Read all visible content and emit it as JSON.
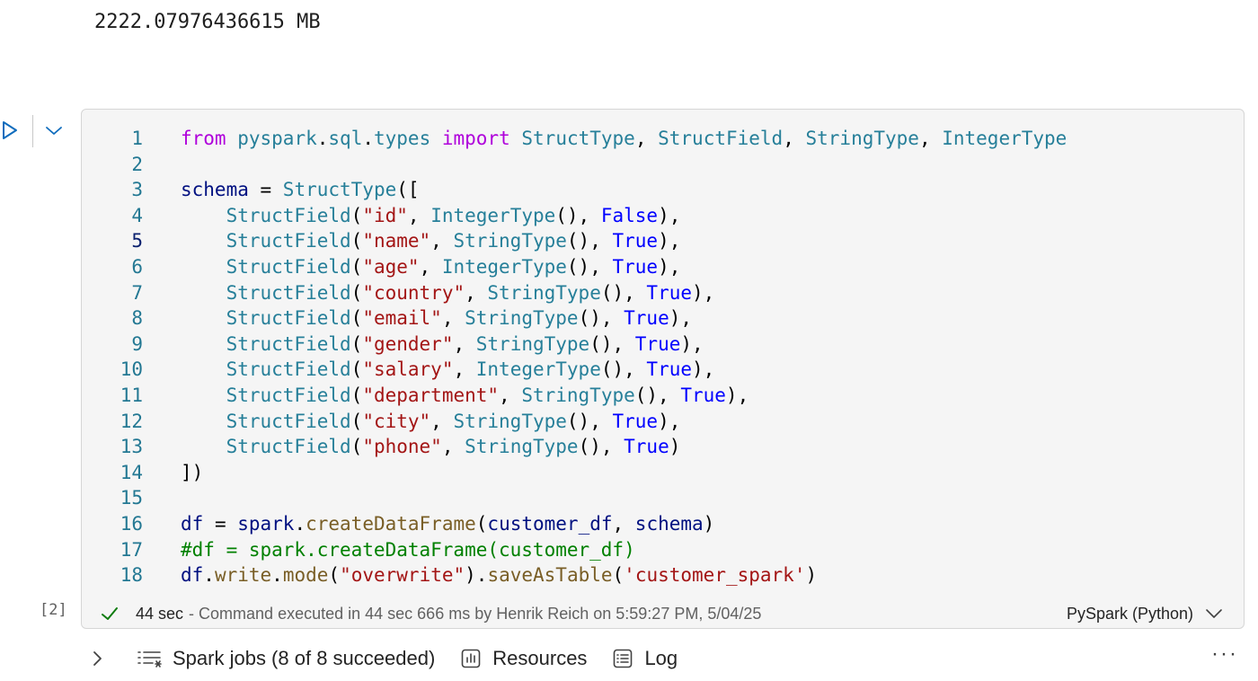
{
  "previous_output": "2222.07976436615 MB",
  "cell": {
    "execution_count": "[2]",
    "code_lines": [
      [
        [
          "kw",
          "from"
        ],
        [
          "p",
          " "
        ],
        [
          "cls",
          "pyspark"
        ],
        [
          "p",
          "."
        ],
        [
          "cls",
          "sql"
        ],
        [
          "p",
          "."
        ],
        [
          "cls",
          "types"
        ],
        [
          "p",
          " "
        ],
        [
          "kw",
          "import"
        ],
        [
          "p",
          " "
        ],
        [
          "cls",
          "StructType"
        ],
        [
          "p",
          ", "
        ],
        [
          "cls",
          "StructField"
        ],
        [
          "p",
          ", "
        ],
        [
          "cls",
          "StringType"
        ],
        [
          "p",
          ", "
        ],
        [
          "cls",
          "IntegerType"
        ]
      ],
      [],
      [
        [
          "var",
          "schema"
        ],
        [
          "p",
          " = "
        ],
        [
          "cls",
          "StructType"
        ],
        [
          "p",
          "(["
        ]
      ],
      [
        [
          "p",
          "    "
        ],
        [
          "cls",
          "StructField"
        ],
        [
          "p",
          "("
        ],
        [
          "str",
          "\"id\""
        ],
        [
          "p",
          ", "
        ],
        [
          "cls",
          "IntegerType"
        ],
        [
          "p",
          "(), "
        ],
        [
          "bool",
          "False"
        ],
        [
          "p",
          "),"
        ]
      ],
      [
        [
          "p",
          "    "
        ],
        [
          "cls",
          "StructField"
        ],
        [
          "p",
          "("
        ],
        [
          "str",
          "\"name\""
        ],
        [
          "p",
          ", "
        ],
        [
          "cls",
          "StringType"
        ],
        [
          "p",
          "(), "
        ],
        [
          "bool",
          "True"
        ],
        [
          "p",
          "),"
        ]
      ],
      [
        [
          "p",
          "    "
        ],
        [
          "cls",
          "StructField"
        ],
        [
          "p",
          "("
        ],
        [
          "str",
          "\"age\""
        ],
        [
          "p",
          ", "
        ],
        [
          "cls",
          "IntegerType"
        ],
        [
          "p",
          "(), "
        ],
        [
          "bool",
          "True"
        ],
        [
          "p",
          "),"
        ]
      ],
      [
        [
          "p",
          "    "
        ],
        [
          "cls",
          "StructField"
        ],
        [
          "p",
          "("
        ],
        [
          "str",
          "\"country\""
        ],
        [
          "p",
          ", "
        ],
        [
          "cls",
          "StringType"
        ],
        [
          "p",
          "(), "
        ],
        [
          "bool",
          "True"
        ],
        [
          "p",
          "),"
        ]
      ],
      [
        [
          "p",
          "    "
        ],
        [
          "cls",
          "StructField"
        ],
        [
          "p",
          "("
        ],
        [
          "str",
          "\"email\""
        ],
        [
          "p",
          ", "
        ],
        [
          "cls",
          "StringType"
        ],
        [
          "p",
          "(), "
        ],
        [
          "bool",
          "True"
        ],
        [
          "p",
          "),"
        ]
      ],
      [
        [
          "p",
          "    "
        ],
        [
          "cls",
          "StructField"
        ],
        [
          "p",
          "("
        ],
        [
          "str",
          "\"gender\""
        ],
        [
          "p",
          ", "
        ],
        [
          "cls",
          "StringType"
        ],
        [
          "p",
          "(), "
        ],
        [
          "bool",
          "True"
        ],
        [
          "p",
          "),"
        ]
      ],
      [
        [
          "p",
          "    "
        ],
        [
          "cls",
          "StructField"
        ],
        [
          "p",
          "("
        ],
        [
          "str",
          "\"salary\""
        ],
        [
          "p",
          ", "
        ],
        [
          "cls",
          "IntegerType"
        ],
        [
          "p",
          "(), "
        ],
        [
          "bool",
          "True"
        ],
        [
          "p",
          "),"
        ]
      ],
      [
        [
          "p",
          "    "
        ],
        [
          "cls",
          "StructField"
        ],
        [
          "p",
          "("
        ],
        [
          "str",
          "\"department\""
        ],
        [
          "p",
          ", "
        ],
        [
          "cls",
          "StringType"
        ],
        [
          "p",
          "(), "
        ],
        [
          "bool",
          "True"
        ],
        [
          "p",
          "),"
        ]
      ],
      [
        [
          "p",
          "    "
        ],
        [
          "cls",
          "StructField"
        ],
        [
          "p",
          "("
        ],
        [
          "str",
          "\"city\""
        ],
        [
          "p",
          ", "
        ],
        [
          "cls",
          "StringType"
        ],
        [
          "p",
          "(), "
        ],
        [
          "bool",
          "True"
        ],
        [
          "p",
          "),"
        ]
      ],
      [
        [
          "p",
          "    "
        ],
        [
          "cls",
          "StructField"
        ],
        [
          "p",
          "("
        ],
        [
          "str",
          "\"phone\""
        ],
        [
          "p",
          ", "
        ],
        [
          "cls",
          "StringType"
        ],
        [
          "p",
          "(), "
        ],
        [
          "bool",
          "True"
        ],
        [
          "p",
          ")"
        ]
      ],
      [
        [
          "p",
          "])"
        ]
      ],
      [],
      [
        [
          "var",
          "df"
        ],
        [
          "p",
          " = "
        ],
        [
          "var",
          "spark"
        ],
        [
          "p",
          "."
        ],
        [
          "fn",
          "createDataFrame"
        ],
        [
          "p",
          "("
        ],
        [
          "var",
          "customer_df"
        ],
        [
          "p",
          ", "
        ],
        [
          "var",
          "schema"
        ],
        [
          "p",
          ")"
        ]
      ],
      [
        [
          "cmt",
          "#df = spark.createDataFrame(customer_df)"
        ]
      ],
      [
        [
          "var",
          "df"
        ],
        [
          "p",
          "."
        ],
        [
          "fn",
          "write"
        ],
        [
          "p",
          "."
        ],
        [
          "fn",
          "mode"
        ],
        [
          "p",
          "("
        ],
        [
          "str",
          "\"overwrite\""
        ],
        [
          "p",
          ")."
        ],
        [
          "fn",
          "saveAsTable"
        ],
        [
          "p",
          "("
        ],
        [
          "str",
          "'customer_spark'"
        ],
        [
          "p",
          ")"
        ]
      ]
    ],
    "active_line": 5,
    "status": {
      "duration": "44 sec",
      "message": "- Command executed in 44 sec 666 ms by Henrik Reich on 5:59:27 PM, 5/04/25",
      "language": "PySpark (Python)"
    }
  },
  "jobs_bar": {
    "spark_jobs": "Spark jobs (8 of 8 succeeded)",
    "resources": "Resources",
    "log": "Log",
    "more": "···"
  },
  "colors": {
    "keyword": "#af00db",
    "class": "#267f99",
    "variable": "#001080",
    "string": "#a31515",
    "boolean": "#0000ff",
    "function": "#795e26",
    "comment": "#008000",
    "success": "#107c10"
  },
  "icons": {
    "run": "play-icon",
    "collapse": "chevron-down-icon",
    "status": "check-icon",
    "expand_jobs": "chevron-right-icon",
    "spark_jobs": "list-icon",
    "resources": "bar-chart-icon",
    "log": "document-list-icon",
    "language_menu": "chevron-down-icon"
  }
}
